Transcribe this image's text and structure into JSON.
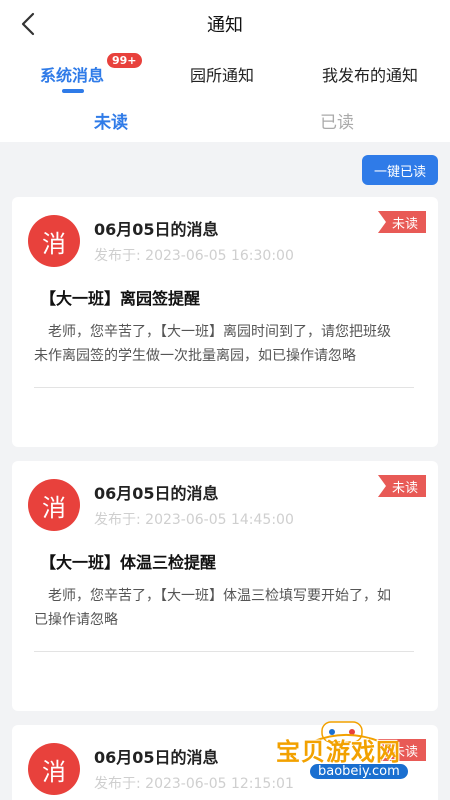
{
  "nav": {
    "title": "通知"
  },
  "tabs": {
    "system": "系统消息",
    "badge": "99+",
    "school": "园所通知",
    "mine": "我发布的通知"
  },
  "subtabs": {
    "unread": "未读",
    "read": "已读"
  },
  "actions": {
    "mark_all_read": "一键已读"
  },
  "cards": [
    {
      "avatar": "消",
      "title": "06月05日的消息",
      "time": "发布于: 2023-06-05 16:30:00",
      "tag": "未读",
      "subject": "【大一班】离园签提醒",
      "body": "老师，您辛苦了，【大一班】离园时间到了，请您把班级未作离园签的学生做一次批量离园，如已操作请忽略"
    },
    {
      "avatar": "消",
      "title": "06月05日的消息",
      "time": "发布于: 2023-06-05 14:45:00",
      "tag": "未读",
      "subject": "【大一班】体温三检提醒",
      "body": "老师，您辛苦了，【大一班】体温三检填写要开始了，如已操作请忽略"
    },
    {
      "avatar": "消",
      "title": "06月05日的消息",
      "time": "发布于: 2023-06-05 12:15:01",
      "tag": "未读"
    }
  ],
  "watermark": {
    "text": "宝贝游戏网",
    "url": "baobeiy.com"
  },
  "colors": {
    "accent": "#2f7be8",
    "red": "#e8413c"
  }
}
